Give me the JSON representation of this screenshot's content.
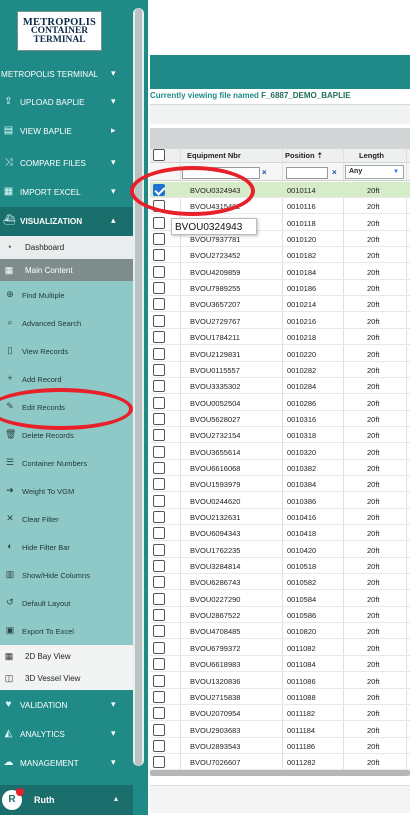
{
  "logo": {
    "line1": "METROPOLIS",
    "line2": "CONTAINER",
    "line3": "TERMINAL"
  },
  "nav": [
    {
      "label": "METROPOLIS TERMINAL",
      "icon": "",
      "caret": "▾"
    },
    {
      "label": "UPLOAD BAPLIE",
      "icon": "upload-icon",
      "caret": "▾"
    },
    {
      "label": "VIEW BAPLIE",
      "icon": "document-icon",
      "caret": "▸"
    },
    {
      "label": "COMPARE FILES",
      "icon": "compare-icon",
      "caret": "▾"
    },
    {
      "label": "IMPORT EXCEL",
      "icon": "excel-icon",
      "caret": "▾"
    },
    {
      "label": "VISUALIZATION",
      "icon": "ship-icon",
      "caret": "▴"
    }
  ],
  "visualization_sub": [
    {
      "label": "Dashboard",
      "icon": "pie-chart-icon"
    },
    {
      "label": "Main Content",
      "icon": "table-icon"
    }
  ],
  "tools": [
    {
      "label": "Find Multiple",
      "icon": "search-plus-icon"
    },
    {
      "label": "Advanced Search",
      "icon": "search-icon"
    },
    {
      "label": "View Records",
      "icon": "file-icon"
    },
    {
      "label": "Add Record",
      "icon": "plus-icon"
    },
    {
      "label": "Edit Records",
      "icon": "pencil-icon"
    },
    {
      "label": "Delete Records",
      "icon": "trash-icon"
    },
    {
      "label": "Container Numbers",
      "icon": "list-icon"
    },
    {
      "label": "Weight To VGM",
      "icon": "arrow-icon"
    },
    {
      "label": "Clear Filter",
      "icon": "x-icon"
    },
    {
      "label": "Hide Filter Bar",
      "icon": "toggle-icon"
    },
    {
      "label": "Show/Hide Columns",
      "icon": "columns-icon"
    },
    {
      "label": "Default Layout",
      "icon": "reset-icon"
    },
    {
      "label": "Export To Excel",
      "icon": "excel-export-icon"
    }
  ],
  "view_sub": [
    {
      "label": "2D Bay View",
      "icon": "grid-icon"
    },
    {
      "label": "3D Vessel View",
      "icon": "cube-icon"
    }
  ],
  "bottom_nav": [
    {
      "label": "VALIDATION",
      "icon": "heart-icon",
      "caret": "▾"
    },
    {
      "label": "ANALYTICS",
      "icon": "chart-icon",
      "caret": "▾"
    },
    {
      "label": "MANAGEMENT",
      "icon": "cloud-icon",
      "caret": "▾"
    }
  ],
  "user": {
    "initial": "R",
    "name": "Ruth",
    "caret": "▴"
  },
  "file_caption": {
    "prefix": "Currently viewing file named",
    "name": "F_6887_DEMO_BAPLIE"
  },
  "columns": {
    "equipment": "Equipment Nbr",
    "position": "Position ⇡",
    "length": "Length"
  },
  "filter": {
    "length_value": "Any",
    "clear": "×"
  },
  "tooltip": "BVOU0324943",
  "rows": [
    {
      "eq": "BVOU0324943",
      "pos": "0010114",
      "len": "20ft",
      "checked": true
    },
    {
      "eq": "BVOU4315462",
      "pos": "0010116",
      "len": "20ft"
    },
    {
      "eq": "BVOU0324943",
      "pos": "0010118",
      "len": "20ft"
    },
    {
      "eq": "BVOU7937781",
      "pos": "0010120",
      "len": "20ft"
    },
    {
      "eq": "BVOU2723452",
      "pos": "0010182",
      "len": "20ft"
    },
    {
      "eq": "BVOU4209859",
      "pos": "0010184",
      "len": "20ft"
    },
    {
      "eq": "BVOU7989255",
      "pos": "0010186",
      "len": "20ft"
    },
    {
      "eq": "BVOU3657207",
      "pos": "0010214",
      "len": "20ft"
    },
    {
      "eq": "BVOU2729767",
      "pos": "0010216",
      "len": "20ft"
    },
    {
      "eq": "BVOU1784211",
      "pos": "0010218",
      "len": "20ft"
    },
    {
      "eq": "BVOU2129831",
      "pos": "0010220",
      "len": "20ft"
    },
    {
      "eq": "BVOU0115557",
      "pos": "0010282",
      "len": "20ft"
    },
    {
      "eq": "BVOU3335302",
      "pos": "0010284",
      "len": "20ft"
    },
    {
      "eq": "BVOU0052504",
      "pos": "0010286",
      "len": "20ft"
    },
    {
      "eq": "BVOU5628027",
      "pos": "0010316",
      "len": "20ft"
    },
    {
      "eq": "BVOU2732154",
      "pos": "0010318",
      "len": "20ft"
    },
    {
      "eq": "BVOU3655614",
      "pos": "0010320",
      "len": "20ft"
    },
    {
      "eq": "BVOU6616068",
      "pos": "0010382",
      "len": "20ft"
    },
    {
      "eq": "BVOU1593979",
      "pos": "0010384",
      "len": "20ft"
    },
    {
      "eq": "BVOU0244620",
      "pos": "0010386",
      "len": "20ft"
    },
    {
      "eq": "BVOU2132631",
      "pos": "0010416",
      "len": "20ft"
    },
    {
      "eq": "BVOU6094343",
      "pos": "0010418",
      "len": "20ft"
    },
    {
      "eq": "BVOU1762235",
      "pos": "0010420",
      "len": "20ft"
    },
    {
      "eq": "BVOU3284814",
      "pos": "0010518",
      "len": "20ft"
    },
    {
      "eq": "BVOU6286743",
      "pos": "0010582",
      "len": "20ft"
    },
    {
      "eq": "BVOU0227290",
      "pos": "0010584",
      "len": "20ft"
    },
    {
      "eq": "BVOU2867522",
      "pos": "0010586",
      "len": "20ft"
    },
    {
      "eq": "BVOU4708485",
      "pos": "0010820",
      "len": "20ft"
    },
    {
      "eq": "BVOU6799372",
      "pos": "0011082",
      "len": "20ft"
    },
    {
      "eq": "BVOU6618983",
      "pos": "0011084",
      "len": "20ft"
    },
    {
      "eq": "BVOU1320836",
      "pos": "0011086",
      "len": "20ft"
    },
    {
      "eq": "BVOU2715838",
      "pos": "0011088",
      "len": "20ft"
    },
    {
      "eq": "BVOU2070954",
      "pos": "0011182",
      "len": "20ft"
    },
    {
      "eq": "BVOU2903683",
      "pos": "0011184",
      "len": "20ft"
    },
    {
      "eq": "BVOU2893543",
      "pos": "0011186",
      "len": "20ft"
    },
    {
      "eq": "BVOU7026607",
      "pos": "0011282",
      "len": "20ft"
    }
  ],
  "colors": {
    "sidebar": "#208a87",
    "sidebar_active": "#1a6e6c",
    "tool_panel": "#8ec9c7",
    "annotation": "#e8202a",
    "selected_row": "#d6ecc8"
  }
}
